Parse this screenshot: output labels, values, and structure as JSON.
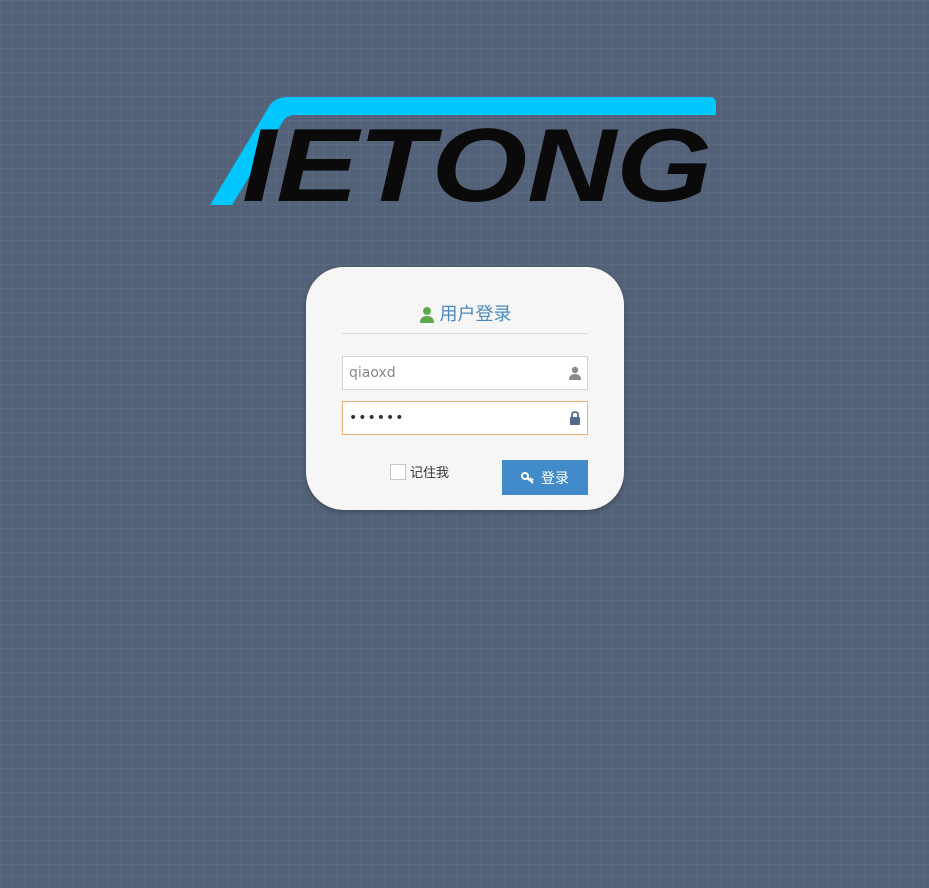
{
  "logo": {
    "text": "IETONG",
    "stripe_color": "#00c8ff",
    "text_color": "#0a0a0a"
  },
  "login": {
    "title": "用户登录",
    "title_icon": "user-icon",
    "username": {
      "value": "qiaoxd",
      "icon": "user-icon"
    },
    "password": {
      "value": "••••••",
      "icon": "lock-icon"
    },
    "remember_label": "记住我",
    "remember_checked": false,
    "submit_label": "登录",
    "submit_icon": "key-icon"
  },
  "colors": {
    "background": "#536279",
    "card": "#f6f6f6",
    "title": "#4a89be",
    "title_icon": "#5fa84a",
    "button": "#428bca",
    "focus_border": "#f0b076"
  }
}
